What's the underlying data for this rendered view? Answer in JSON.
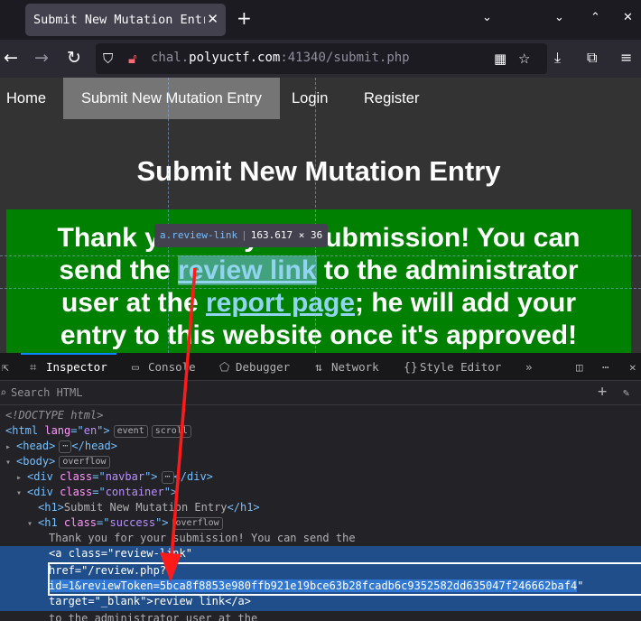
{
  "browser": {
    "tab_title": "Submit New Mutation Entry",
    "url_host_prefix": "chal.",
    "url_host": "polyuctf.com",
    "url_rest": ":41340/submit.php"
  },
  "site": {
    "nav": [
      "Home",
      "Submit New Mutation Entry",
      "Login",
      "Register"
    ],
    "heading": "Submit New Mutation Entry",
    "msg_line1": "Thank you for your submission! You can",
    "msg_line2_pre": "send the ",
    "msg_line2_link": "review link",
    "msg_line2_post": " to the administrator",
    "msg_line3_pre": "user at the ",
    "msg_line3_link": "report page",
    "msg_line3_post": "; he will add your",
    "msg_line4": "entry to this website once it's approved!",
    "tooltip_tag": "a.review-link",
    "tooltip_size": "163.617 × 36"
  },
  "devtools": {
    "tabs": [
      "Inspector",
      "Console",
      "Debugger",
      "Network",
      "Style Editor"
    ],
    "search_placeholder": "Search HTML",
    "doctype": "<!DOCTYPE html>",
    "badges": {
      "event": "event",
      "scroll": "scroll",
      "overflow": "overflow"
    },
    "text_line": "Thank you for your submission! You can send the",
    "href_value": "/review.php?",
    "href_query": "id=1&reviewToken=5bca8f8853e980ffb921e19bce63b28fcadb6c9352582dd635047f246662baf4",
    "link_text": "review link",
    "text_line2": "to the administrator user at the"
  }
}
